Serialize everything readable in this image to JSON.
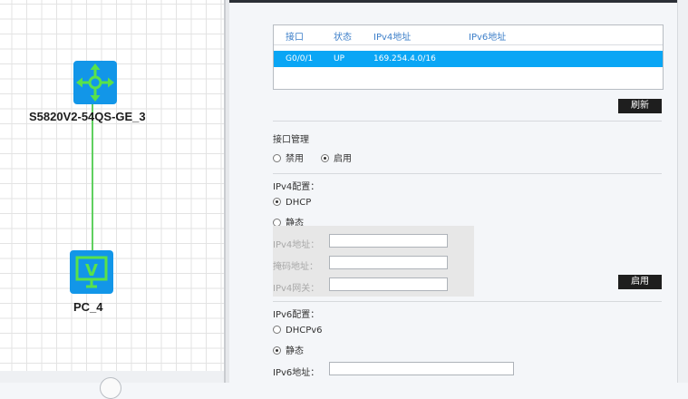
{
  "topology": {
    "devices": [
      {
        "label": "S5820V2-54QS-GE_3",
        "icon": "switch-icon"
      },
      {
        "label": "PC_4",
        "icon": "pc-monitor-icon"
      }
    ],
    "pc_icon_letter": "V",
    "colors": {
      "device": "#1296e8",
      "device_glyph": "#59e24a",
      "link": "#5fd05f"
    }
  },
  "interfaces": {
    "columns": [
      "接口",
      "状态",
      "IPv4地址",
      "IPv6地址"
    ],
    "rows": [
      {
        "interface": "G0/0/1",
        "status": "UP",
        "ipv4": "169.254.4.0/16",
        "ipv6": ""
      }
    ],
    "selected_row_color": "#0aa6f5"
  },
  "buttons": {
    "refresh": "刷新",
    "enable": "启用"
  },
  "interface_mgmt": {
    "title": "接口管理",
    "options": [
      {
        "label": "禁用",
        "selected": false
      },
      {
        "label": "启用",
        "selected": true
      }
    ]
  },
  "ipv4": {
    "title": "IPv4配置：",
    "options": [
      {
        "label": "DHCP",
        "selected": true
      },
      {
        "label": "静态",
        "selected": false
      }
    ],
    "fields": [
      {
        "label": "IPv4地址：",
        "value": ""
      },
      {
        "label": "掩码地址：",
        "value": ""
      },
      {
        "label": "IPv4网关：",
        "value": ""
      }
    ]
  },
  "ipv6": {
    "title": "IPv6配置：",
    "options": [
      {
        "label": "DHCPv6",
        "selected": false
      },
      {
        "label": "静态",
        "selected": true
      }
    ],
    "fields": [
      {
        "label": "IPv6地址：",
        "value": ""
      }
    ]
  }
}
